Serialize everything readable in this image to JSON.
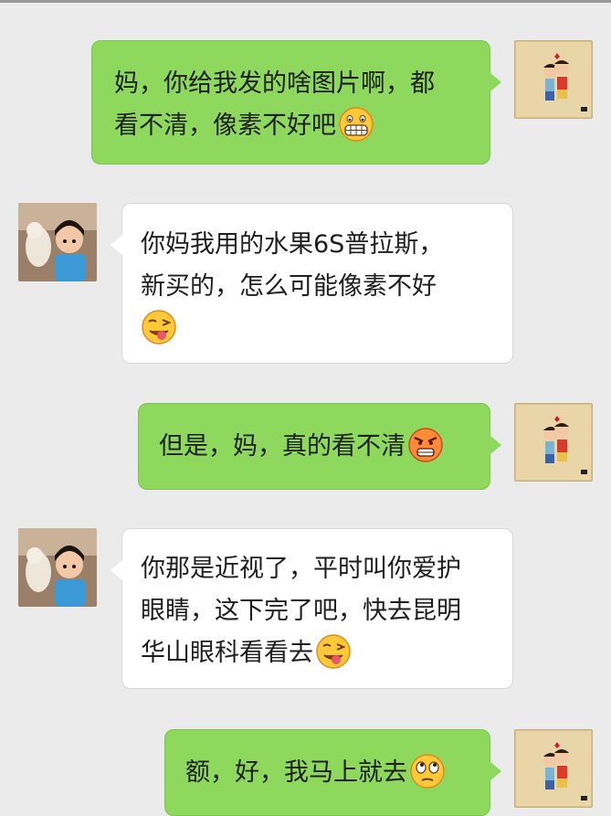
{
  "messages": [
    {
      "side": "right",
      "lines": [
        "妈，你给我发的啥图片啊，都",
        "看不清，像素不好吧"
      ],
      "emoji": "grinning-teeth-emoji"
    },
    {
      "side": "left",
      "lines": [
        "你妈我用的水果6S普拉斯，",
        "新买的，怎么可能像素不好"
      ],
      "emoji": "tongue-out-emoji"
    },
    {
      "side": "right",
      "lines": [
        "但是，妈，真的看不清"
      ],
      "emoji": "angry-face-emoji"
    },
    {
      "side": "left",
      "lines": [
        "你那是近视了，平时叫你爱护",
        "眼睛，这下完了吧，快去昆明",
        "华山眼科看看去"
      ],
      "emoji": "tongue-out-emoji"
    },
    {
      "side": "right",
      "lines": [
        "额，好，我马上就去"
      ],
      "emoji": "rolling-eyes-emoji"
    }
  ],
  "colors": {
    "background": "#ebebeb",
    "sent_bubble": "#8ed85e",
    "received_bubble": "#ffffff"
  }
}
